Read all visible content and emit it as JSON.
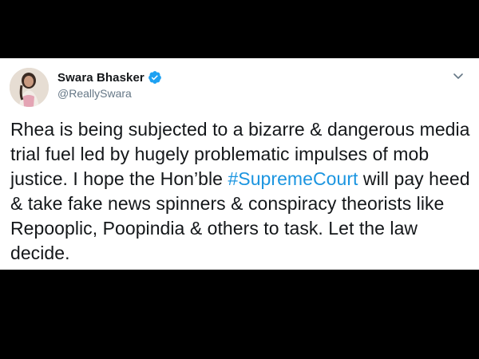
{
  "tweet": {
    "author": {
      "name": "Swara Bhasker",
      "handle": "@ReallySwara",
      "verified": true,
      "avatar_icon": "profile-photo"
    },
    "menu_icon": "chevron-down-icon",
    "text_before_hashtag": "Rhea is being subjected to a bizarre & dangerous media trial fuel led by hugely problematic impulses of mob justice. I hope the Hon’ble ",
    "hashtag": "#SupremeCourt",
    "text_after_hashtag": " will pay heed & take fake news spinners & conspiracy theorists like Repooplic, Poopindia & others to task. Let the law decide."
  },
  "colors": {
    "background": "#000000",
    "card": "#ffffff",
    "text": "#14171a",
    "handle": "#657786",
    "hashtag": "#1b95e0",
    "verified": "#1da1f2"
  }
}
